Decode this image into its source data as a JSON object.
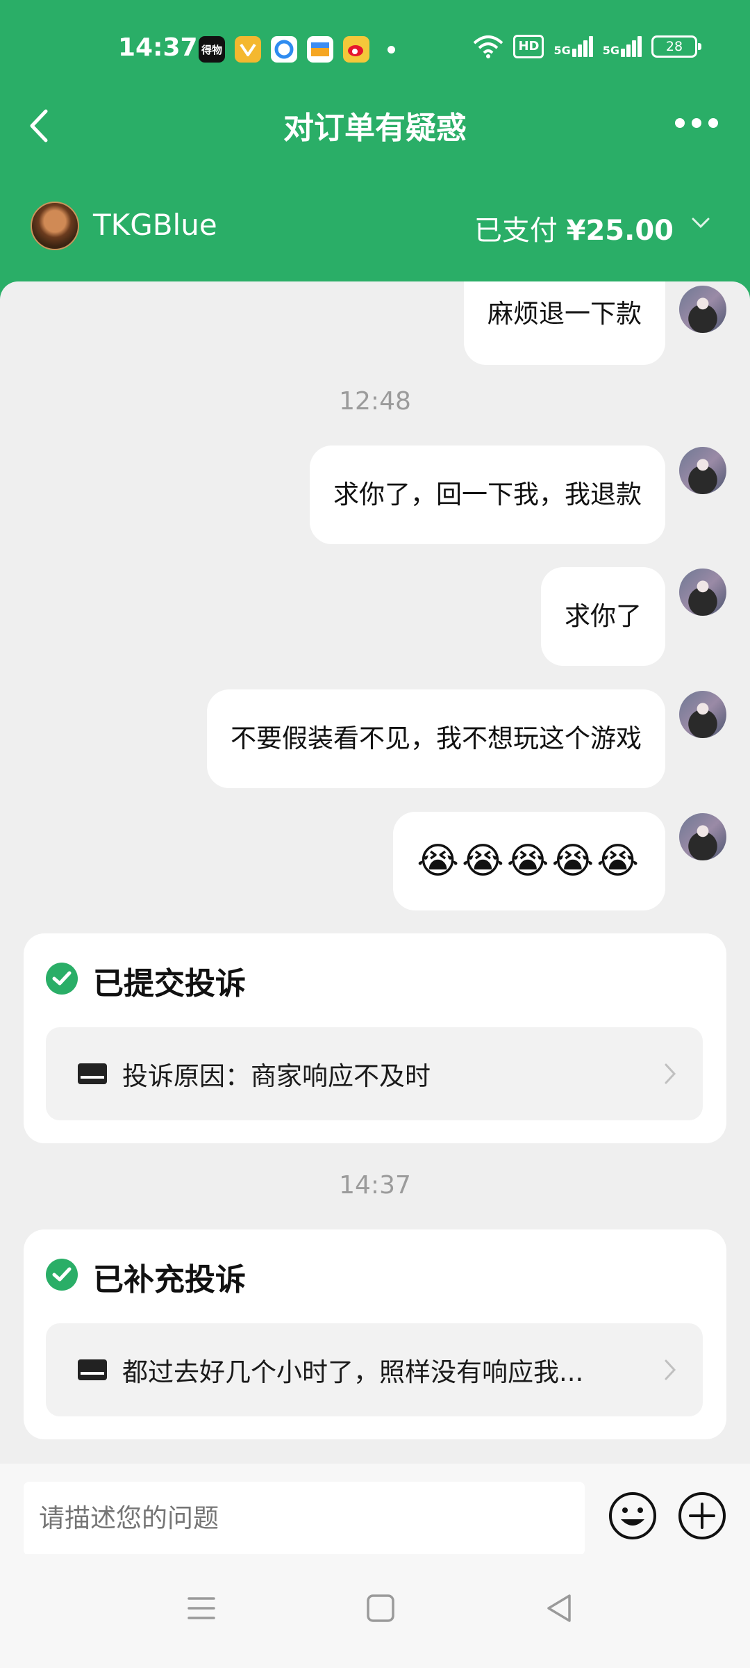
{
  "status_bar": {
    "time": "14:37",
    "app_icons": [
      {
        "name": "dewu-app-icon",
        "label": "得物",
        "color": "#111111"
      },
      {
        "name": "vip-app-icon",
        "label": "",
        "color": "#f4b82f"
      },
      {
        "name": "qq-browser-app-icon",
        "label": "",
        "color": "#2f8cf0"
      },
      {
        "name": "wallet-app-icon",
        "label": "",
        "color": "#3d8df2"
      },
      {
        "name": "weibo-app-icon",
        "label": "",
        "color": "#f5c83a"
      }
    ],
    "hd": "HD",
    "signal1": "5G",
    "signal2": "5G",
    "battery": "28"
  },
  "nav": {
    "title": "对订单有疑惑"
  },
  "order": {
    "username": "TKGBlue",
    "paid_prefix": "已支付",
    "amount": "¥25.00"
  },
  "messages": {
    "m1": "麻烦退一下款",
    "ts1": "12:48",
    "m2": "求你了，回一下我，我退款",
    "m3": "求你了",
    "m4": "不要假装看不见，我不想玩这个游戏",
    "m5": "😭😭😭😭😭"
  },
  "complaint1": {
    "title": "已提交投诉",
    "reason": "投诉原因：商家响应不及时"
  },
  "ts2": "14:37",
  "complaint2": {
    "title": "已补充投诉",
    "reason": "都过去好几个小时了，照样没有响应我..."
  },
  "input": {
    "placeholder": "请描述您的问题"
  },
  "colors": {
    "brand_green": "#2aae67",
    "chat_bg": "#efefef"
  }
}
